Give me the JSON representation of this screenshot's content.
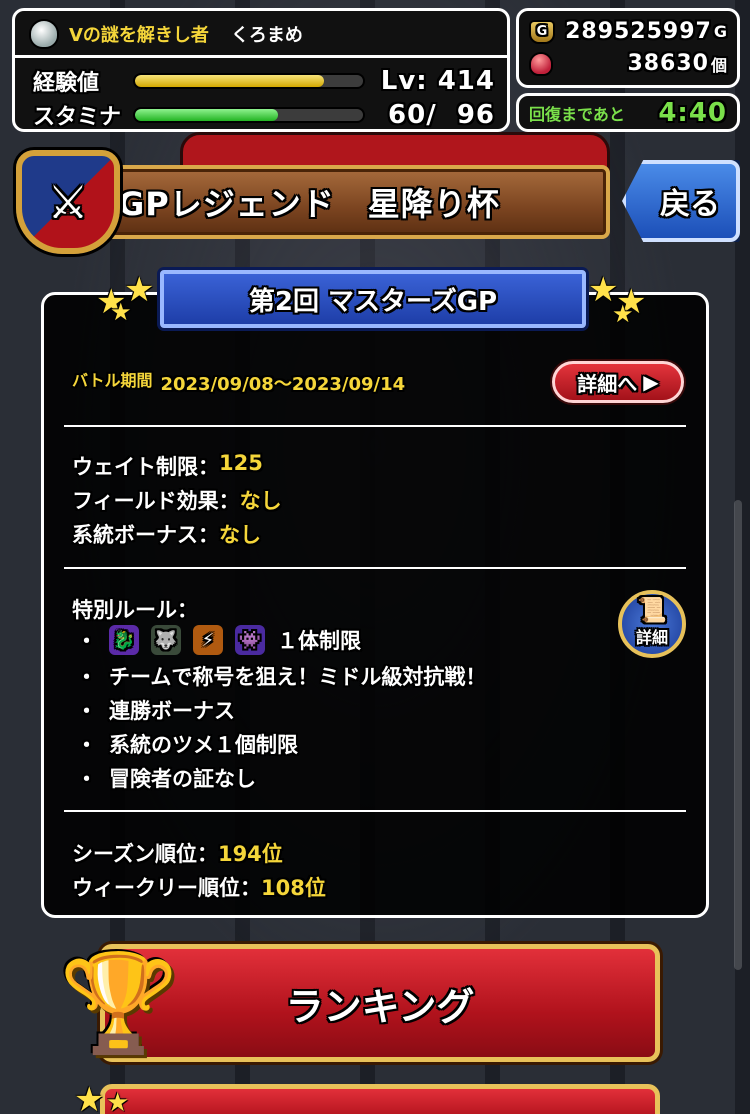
{
  "player": {
    "title": "Vの謎を解きし者",
    "name": "くろまめ",
    "exp_label": "経験値",
    "exp_fill": 0.83,
    "level": "Lv: 414",
    "stamina_label": "スタミナ",
    "stamina_fill": 0.625,
    "stamina_text": "60/  96"
  },
  "currency": {
    "gold": "289525997",
    "gold_unit": "G",
    "gold_icon_glyph": "G",
    "gems": "38630",
    "gems_unit": "個"
  },
  "recovery": {
    "label": "回復まであと",
    "time": "4:40"
  },
  "header": {
    "title": "GPレジェンド　星降り杯",
    "emblem_glyph": "⚔",
    "back_label": "戻る"
  },
  "event": {
    "ribbon_title": "第2回 マスターズGP",
    "period_label": "バトル期間",
    "period": "2023/09/08～2023/09/14",
    "detail_button": "詳細へ",
    "detail_arrow": "▶"
  },
  "rules": {
    "weight_label": "ウェイト制限：",
    "weight_value": "125",
    "field_label": "フィールド効果：",
    "field_value": "なし",
    "lineage_label": "系統ボーナス：",
    "lineage_value": "なし",
    "special_label": "特別ルール：",
    "bullet": "・",
    "limit_text": "１体制限",
    "monster_icons": [
      "purple-dragon-icon",
      "white-beast-icon",
      "orange-slash-icon",
      "purple-demon-icon"
    ],
    "items": [
      "チームで称号を狙え！ミドル級対抗戦！",
      "連勝ボーナス",
      "系統のツメ１個制限",
      "冒険者の証なし"
    ],
    "scroll_label": "詳細",
    "scroll_glyph": "📜"
  },
  "ranks": {
    "season_label": "シーズン順位：",
    "season_value": "194位",
    "weekly_label": "ウィークリー順位：",
    "weekly_value": "108位"
  },
  "ranking_button": {
    "label": "ランキング",
    "trophy_glyph": "🏆"
  },
  "colors": {
    "accent_yellow": "#f5d63a",
    "recovery_green": "#7ae04a",
    "button_red": "#b0121c",
    "ribbon_blue": "#1e3ea8"
  }
}
